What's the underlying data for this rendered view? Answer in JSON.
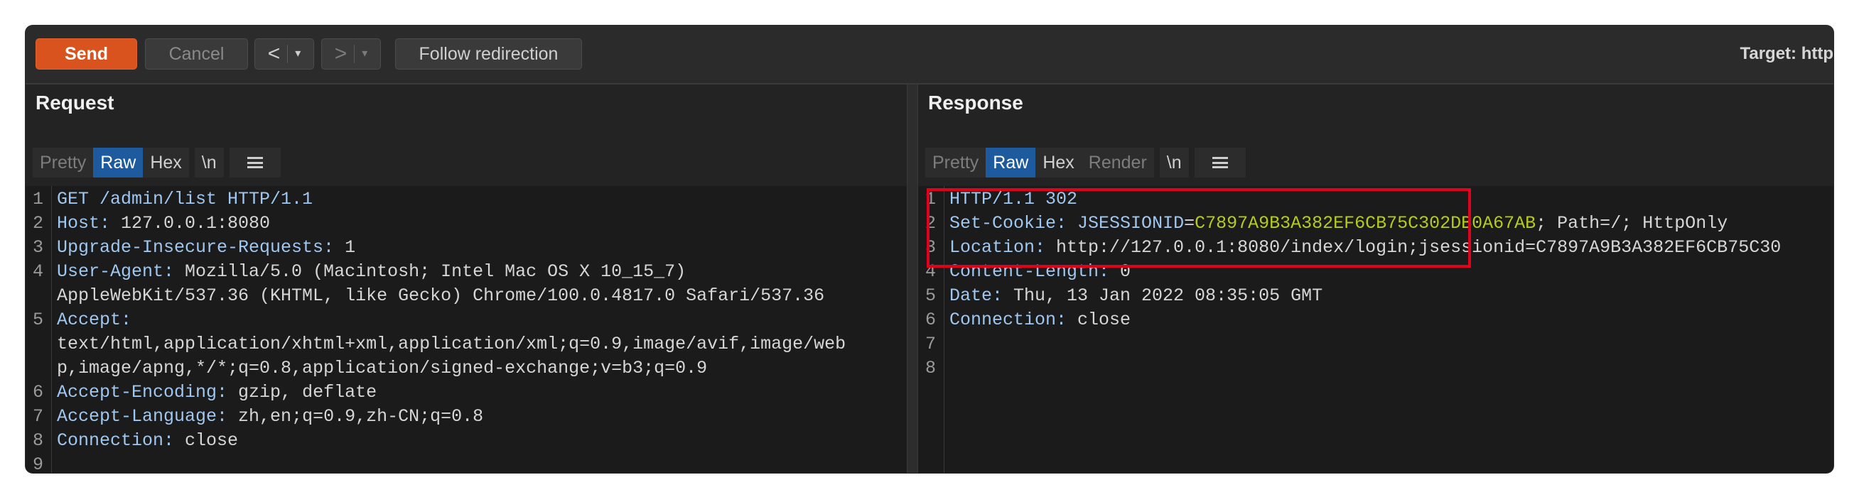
{
  "toolbar": {
    "send_label": "Send",
    "cancel_label": "Cancel",
    "back_arrow": "<",
    "forward_arrow": ">",
    "dropdown_glyph": "▾",
    "follow_label": "Follow redirection",
    "target_label": "Target: http"
  },
  "request": {
    "title": "Request",
    "tabs": [
      "Pretty",
      "Raw",
      "Hex",
      "\\n"
    ],
    "active_tab": "Raw",
    "lines": [
      {
        "n": "1",
        "key": "GET /admin/list HTTP/1.1",
        "val": ""
      },
      {
        "n": "2",
        "key": "Host:",
        "val": " 127.0.0.1:8080"
      },
      {
        "n": "3",
        "key": "Upgrade-Insecure-Requests:",
        "val": " 1"
      },
      {
        "n": "4",
        "key": "User-Agent:",
        "val": " Mozilla/5.0 (Macintosh; Intel Mac OS X 10_15_7)"
      },
      {
        "n": "",
        "key": "",
        "val": "AppleWebKit/537.36 (KHTML, like Gecko) Chrome/100.0.4817.0 Safari/537.36"
      },
      {
        "n": "5",
        "key": "Accept:",
        "val": ""
      },
      {
        "n": "",
        "key": "",
        "val": "text/html,application/xhtml+xml,application/xml;q=0.9,image/avif,image/web"
      },
      {
        "n": "",
        "key": "",
        "val": "p,image/apng,*/*;q=0.8,application/signed-exchange;v=b3;q=0.9"
      },
      {
        "n": "6",
        "key": "Accept-Encoding:",
        "val": " gzip, deflate"
      },
      {
        "n": "7",
        "key": "Accept-Language:",
        "val": " zh,en;q=0.9,zh-CN;q=0.8"
      },
      {
        "n": "8",
        "key": "Connection:",
        "val": " close"
      },
      {
        "n": "9",
        "key": "",
        "val": ""
      }
    ]
  },
  "response": {
    "title": "Response",
    "tabs": [
      "Pretty",
      "Raw",
      "Hex",
      "Render",
      "\\n"
    ],
    "active_tab": "Raw",
    "lines": [
      {
        "n": "1",
        "key": "HTTP/1.1 302",
        "val": ""
      },
      {
        "n": "2",
        "key": "Set-Cookie:",
        "val": " ",
        "ck": "JSESSIONID",
        "eq": "=",
        "cv": "C7897A9B3A382EF6CB75C302DB0A67AB",
        "rest": "; Path=/; HttpOnly"
      },
      {
        "n": "3",
        "key": "Location:",
        "val": " http://127.0.0.1:8080/index/login;jsessionid=C7897A9B3A382EF6CB75C30"
      },
      {
        "n": "4",
        "key": "Content-Length:",
        "val": " 0"
      },
      {
        "n": "5",
        "key": "Date:",
        "val": " Thu, 13 Jan 2022 08:35:05 GMT"
      },
      {
        "n": "6",
        "key": "Connection:",
        "val": " close"
      },
      {
        "n": "7",
        "key": "",
        "val": ""
      },
      {
        "n": "8",
        "key": "",
        "val": ""
      }
    ]
  },
  "colors": {
    "send": "#d9531e",
    "active_tab": "#1d5a9e",
    "highlight": "#e3001b",
    "cookie_value": "#b5cc18",
    "header_key": "#9fc7ef"
  }
}
